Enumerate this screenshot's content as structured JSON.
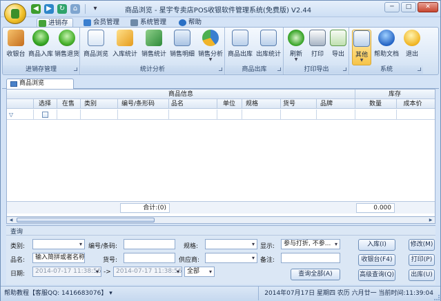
{
  "window": {
    "title": "商品浏览 - 星宇专卖店POS收银软件管理系统(免费版) V2.44",
    "min": "─",
    "max": "□",
    "close": "✕"
  },
  "menu_tabs": [
    {
      "label": "进销存",
      "active": true
    },
    {
      "label": "会员管理",
      "active": false
    },
    {
      "label": "系统管理",
      "active": false
    },
    {
      "label": "帮助",
      "active": false
    }
  ],
  "ribbon": {
    "groups": [
      {
        "label": "进销存管理",
        "buttons": [
          {
            "label": "收银台",
            "icon": "cash-register-icon"
          },
          {
            "label": "商品入库",
            "icon": "stock-in-icon"
          },
          {
            "label": "销售退货",
            "icon": "return-icon"
          }
        ]
      },
      {
        "label": "统计分析",
        "buttons": [
          {
            "label": "商品浏览",
            "icon": "browse-icon"
          },
          {
            "label": "入库统计",
            "icon": "stats-icon"
          },
          {
            "label": "销售统计",
            "icon": "sales-stats-icon"
          },
          {
            "label": "销售明细",
            "icon": "sales-detail-icon"
          },
          {
            "label": "销售分析",
            "icon": "analysis-icon"
          }
        ]
      },
      {
        "label": "商品出库",
        "buttons": [
          {
            "label": "商品出库",
            "icon": "stock-out-icon"
          },
          {
            "label": "出库统计",
            "icon": "out-stats-icon"
          }
        ]
      },
      {
        "label": "打印导出",
        "buttons": [
          {
            "label": "刷新",
            "icon": "refresh-icon"
          },
          {
            "label": "打印",
            "icon": "printer-icon"
          },
          {
            "label": "导出",
            "icon": "export-icon"
          }
        ]
      },
      {
        "label": "系统",
        "buttons": [
          {
            "label": "其他",
            "icon": "other-icon"
          },
          {
            "label": "帮助文档",
            "icon": "help-icon"
          },
          {
            "label": "退出",
            "icon": "exit-icon"
          }
        ]
      }
    ]
  },
  "document_tab": "商品浏览",
  "grid": {
    "group_headers": {
      "info": "商品信息",
      "stock": "库存"
    },
    "columns": [
      "选择",
      "在售",
      "类别",
      "编号/条形码",
      "品名",
      "单位",
      "规格",
      "货号",
      "品牌",
      "数量",
      "成本价"
    ],
    "filter_icon": "▽",
    "sum_label": "合计:(0)",
    "sum_value": "0.000"
  },
  "query": {
    "title": "查询",
    "labels": {
      "category": "类别:",
      "code": "编号/条码:",
      "spec": "规格:",
      "display": "显示:",
      "name": "品名:",
      "itemno": "货号:",
      "supplier": "供应商:",
      "remark": "备注:",
      "date": "日期:",
      "arrow": "->"
    },
    "values": {
      "display": "参与打折, 不参...",
      "name": "输入简拼或者名称",
      "date_from": "2014-07-17 11:38:56",
      "date_to": "2014-07-17 11:38:56",
      "range": "全部"
    },
    "buttons": {
      "query_all": "查询全部(A)",
      "stock_in": "入库(I)",
      "modify": "修改(M)",
      "cashier": "收银台(F4)",
      "print": "打印(P)",
      "advanced": "高级查询(Q)",
      "stock_out": "出库(U)"
    }
  },
  "status": {
    "left": "帮助教程【客服QQ: 1416683076】",
    "left_dropdown": "▾",
    "right": "2014年07月17日 星期四 农历 六月廿一  当前时间:11:39:04"
  }
}
